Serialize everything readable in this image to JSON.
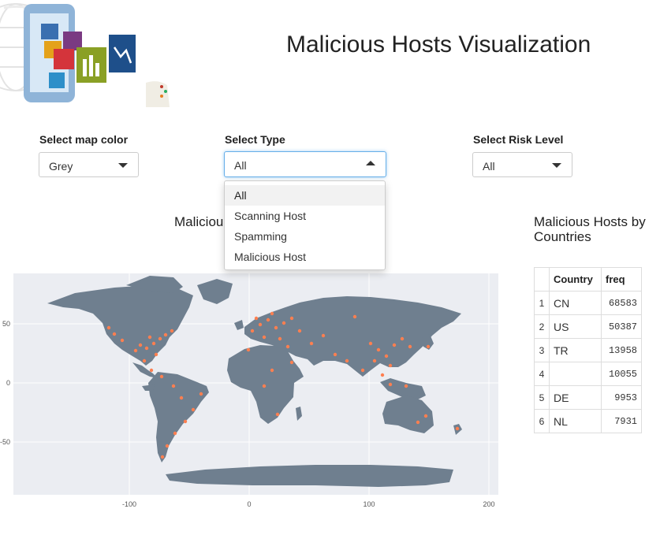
{
  "page": {
    "title": "Malicious Hosts Visualization"
  },
  "controls": {
    "map_color": {
      "label": "Select map color",
      "value": "Grey"
    },
    "type": {
      "label": "Select Type",
      "value": "All",
      "options": [
        "All",
        "Scanning Host",
        "Spamming",
        "Malicious Host"
      ]
    },
    "risk": {
      "label": "Select Risk Level",
      "value": "All"
    }
  },
  "map_section": {
    "title": "Malicious Hosts",
    "title_visible": "Maliciou",
    "x_ticks": [
      "-100",
      "0",
      "100",
      "200"
    ],
    "y_ticks": [
      "50",
      "0",
      "-50"
    ],
    "colors": {
      "land": "#6f7f8f",
      "points": "#ff7f50",
      "panel": "#ebedf2"
    }
  },
  "table_section": {
    "title_line1": "Malicious Hosts by",
    "title_line2": "Countries",
    "headers": [
      "",
      "Country",
      "freq"
    ],
    "rows": [
      {
        "idx": "1",
        "country": "CN",
        "freq": "68583"
      },
      {
        "idx": "2",
        "country": "US",
        "freq": "50387"
      },
      {
        "idx": "3",
        "country": "TR",
        "freq": "13958"
      },
      {
        "idx": "4",
        "country": "",
        "freq": "10055"
      },
      {
        "idx": "5",
        "country": "DE",
        "freq": "9953"
      },
      {
        "idx": "6",
        "country": "NL",
        "freq": "7931"
      }
    ]
  }
}
